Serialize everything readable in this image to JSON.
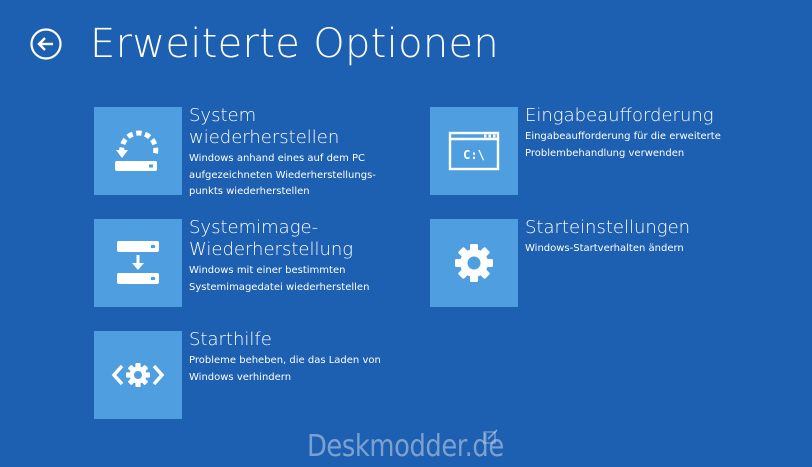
{
  "header": {
    "title": "Erweiterte Optionen"
  },
  "options": [
    {
      "title": "System\nwiederherstellen",
      "description": "Windows anhand eines auf dem PC\naufgezeichneten Wiederherstellungs-\npunkts wiederherstellen",
      "icon": "system-restore-icon"
    },
    {
      "title": "Systemimage-\nWiederherstellung",
      "description": "Windows mit einer bestimmten\nSystemimagedatei wiederherstellen",
      "icon": "system-image-recovery-icon"
    },
    {
      "title": "Starthilfe",
      "description": "Probleme beheben, die das Laden von\nWindows verhindern",
      "icon": "startup-repair-icon"
    },
    {
      "title": "Eingabeaufforderung",
      "description": "Eingabeaufforderung für die erweiterte\nProblembehandlung verwenden",
      "icon": "command-prompt-icon",
      "icon_text": "C:\\"
    },
    {
      "title": "Starteinstellungen",
      "description": "Windows-Startverhalten ändern",
      "icon": "gear-icon"
    }
  ],
  "watermark": {
    "text": "Deskmodder.de"
  },
  "colors": {
    "background": "#1d5fb0",
    "tile": "#4f9ee0",
    "text": "#ffffff"
  }
}
